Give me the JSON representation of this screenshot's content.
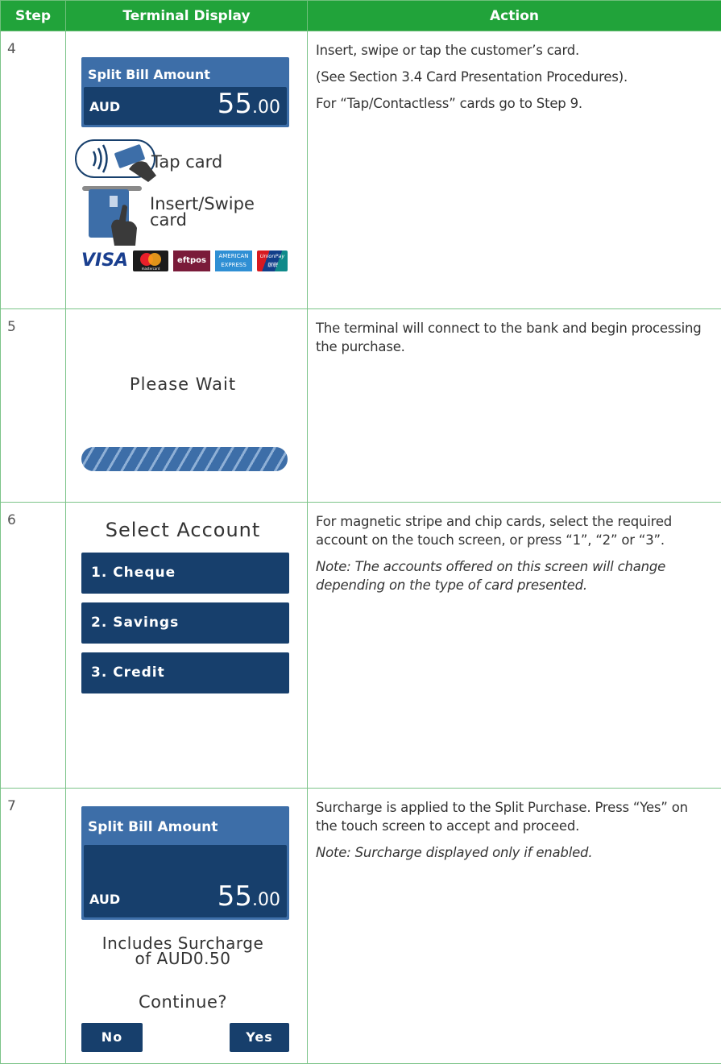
{
  "headers": {
    "step": "Step",
    "display": "Terminal Display",
    "action": "Action"
  },
  "rows": [
    {
      "step": "4",
      "display": {
        "title": "Split Bill Amount",
        "currency": "AUD",
        "amount_main": "55",
        "amount_cents": ".00",
        "tap_label": "Tap card",
        "insert_label_1": "Insert/Swipe",
        "insert_label_2": "card",
        "logos": {
          "visa": "VISA",
          "mastercard": "mastercard",
          "eftpos": "eftpos",
          "amex_1": "AMERICAN",
          "amex_2": "EXPRESS",
          "unionpay_1": "UnionPay",
          "unionpay_2": "银联"
        }
      },
      "action": [
        "Insert, swipe or tap the customer’s card.",
        "(See Section 3.4 Card Presentation Procedures).",
        "For “Tap/Contactless” cards go to Step 9."
      ]
    },
    {
      "step": "5",
      "display": {
        "message": "Please Wait"
      },
      "action": [
        "The terminal will connect to the bank and begin processing the purchase."
      ]
    },
    {
      "step": "6",
      "display": {
        "title": "Select Account",
        "options": [
          "1. Cheque",
          "2. Savings",
          "3. Credit"
        ]
      },
      "action": [
        "For magnetic stripe and chip cards, select the required account on the touch screen, or press “1”, “2” or “3”."
      ],
      "note": "Note: The accounts offered on this screen will change depending on the type of card presented."
    },
    {
      "step": "7",
      "display": {
        "title": "Split Bill Amount",
        "currency": "AUD",
        "amount_main": "55",
        "amount_cents": ".00",
        "surcharge_1": "Includes Surcharge",
        "surcharge_2": "of AUD0.50",
        "prompt": "Continue?",
        "no": "No",
        "yes": "Yes"
      },
      "action": [
        "Surcharge is applied to the Split Purchase. Press “Yes” on the touch screen to accept and proceed."
      ],
      "note": "Note: Surcharge displayed only if enabled."
    }
  ],
  "colors": {
    "header_green": "#21a33a",
    "border_green": "#7cc489",
    "screen_blue": "#3d6ea8",
    "screen_navy": "#173f6c"
  }
}
